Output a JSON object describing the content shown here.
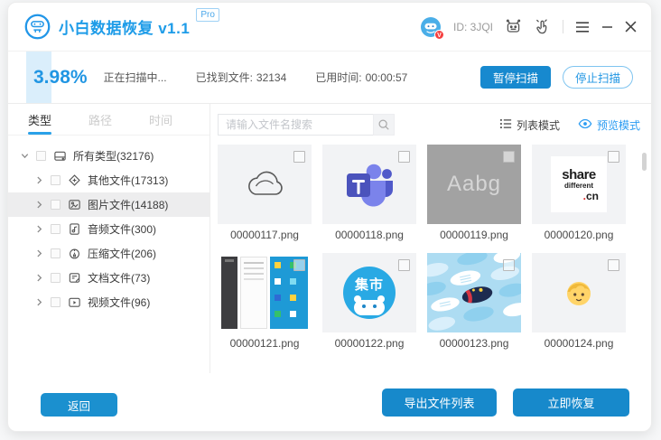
{
  "header": {
    "app_title": "小白数据恢复 v1.1",
    "pro_badge": "Pro",
    "user_id": "ID: 3JQI",
    "avatar_badge": "V"
  },
  "scan": {
    "percent": "3.98%",
    "progress_fill_percent": 3.98,
    "status": "正在扫描中...",
    "found_label": "已找到文件:",
    "found_value": "32134",
    "elapsed_label": "已用时间:",
    "elapsed_value": "00:00:57",
    "pause_button": "暂停扫描",
    "stop_button": "停止扫描"
  },
  "sidebar": {
    "tabs": [
      {
        "label": "类型",
        "active": true
      },
      {
        "label": "路径",
        "active": false
      },
      {
        "label": "时间",
        "active": false
      }
    ],
    "tree": [
      {
        "label": "所有类型(32176)",
        "icon": "disk-icon",
        "level": 0,
        "expanded": true,
        "selected": false
      },
      {
        "label": "其他文件(17313)",
        "icon": "other-file-icon",
        "level": 1,
        "expanded": false,
        "selected": false
      },
      {
        "label": "图片文件(14188)",
        "icon": "image-file-icon",
        "level": 1,
        "expanded": false,
        "selected": true
      },
      {
        "label": "音频文件(300)",
        "icon": "audio-file-icon",
        "level": 1,
        "expanded": false,
        "selected": false
      },
      {
        "label": "压缩文件(206)",
        "icon": "zip-file-icon",
        "level": 1,
        "expanded": false,
        "selected": false
      },
      {
        "label": "文档文件(73)",
        "icon": "doc-file-icon",
        "level": 1,
        "expanded": false,
        "selected": false
      },
      {
        "label": "视频文件(96)",
        "icon": "video-file-icon",
        "level": 1,
        "expanded": false,
        "selected": false
      }
    ]
  },
  "toolbar": {
    "search_placeholder": "请输入文件名搜索",
    "list_mode_label": "列表模式",
    "preview_mode_label": "预览模式"
  },
  "grid": {
    "cards": [
      {
        "name": "00000117.png",
        "thumb": "cloud-outline-thumb"
      },
      {
        "name": "00000118.png",
        "thumb": "teams-logo-thumb"
      },
      {
        "name": "00000119.png",
        "thumb": "font-sample-thumb",
        "text": "Aabg"
      },
      {
        "name": "00000120.png",
        "thumb": "share-cn-logo-thumb",
        "text": "share different .cn"
      },
      {
        "name": "00000121.png",
        "thumb": "desktop-screenshot-thumb"
      },
      {
        "name": "00000122.png",
        "thumb": "jishi-mascot-thumb",
        "text": "集市"
      },
      {
        "name": "00000123.png",
        "thumb": "fish-pattern-thumb"
      },
      {
        "name": "00000124.png",
        "thumb": "child-emoji-thumb"
      }
    ]
  },
  "footer": {
    "back_button": "返回",
    "export_button": "导出文件列表",
    "recover_button": "立即恢复"
  },
  "colors": {
    "brand_blue": "#1e9ce8",
    "button_blue": "#1789cb",
    "progress_fill": "#daeefb",
    "preview_link": "#2b9cf2"
  }
}
